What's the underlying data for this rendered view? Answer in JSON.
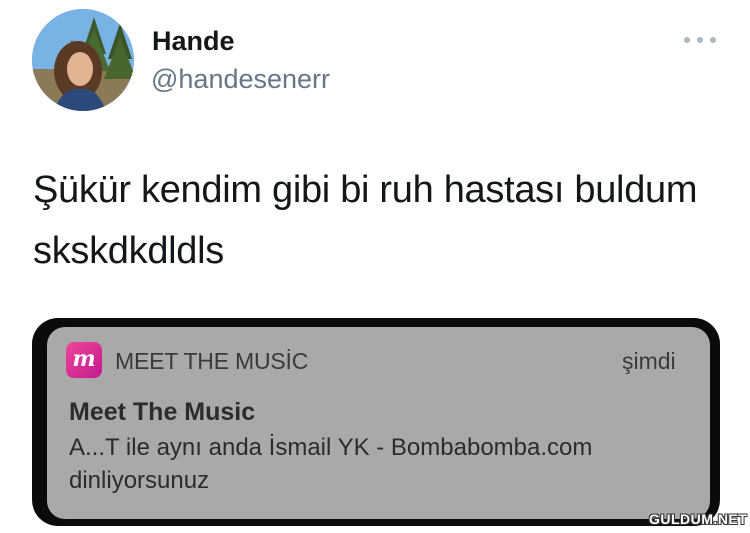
{
  "tweet": {
    "author": {
      "name": "Hande",
      "handle": "@handesenerr"
    },
    "more_icon": "more-horizontal-icon",
    "text": "Şükür kendim gibi bi ruh hastası buldum skskdkdldls"
  },
  "notification": {
    "app_icon_letter": "m",
    "app_name": "MEET THE MUSİC",
    "time": "şimdi",
    "title": "Meet The Music",
    "body": "A...T ile aynı anda İsmail YK - Bombabomba.com dinliyorsunuz",
    "colors": {
      "card": "#a9a9a9",
      "icon_start": "#f0469a",
      "icon_end": "#c21a8e"
    }
  },
  "watermark": "GULDUM.NET"
}
